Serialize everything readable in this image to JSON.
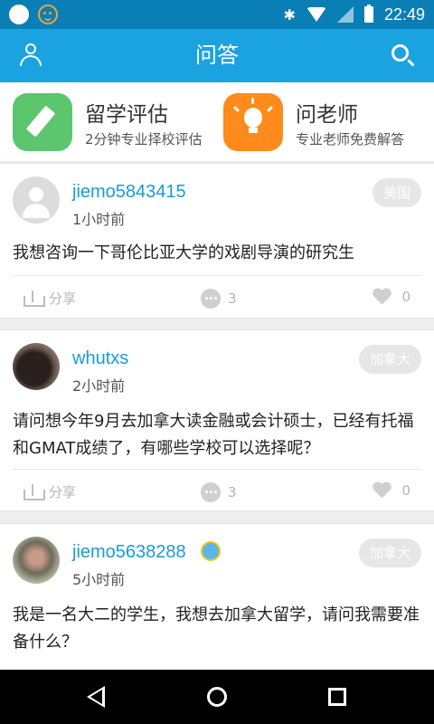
{
  "status_bar": {
    "time": "22:49",
    "bluetooth": "✱"
  },
  "app_bar": {
    "title": "问答"
  },
  "quick_actions": [
    {
      "title": "留学评估",
      "subtitle": "2分钟专业择校评估",
      "icon": "pencil-icon",
      "color": "#5bc66e"
    },
    {
      "title": "问老师",
      "subtitle": "专业老师免费解答",
      "icon": "lightbulb-icon",
      "color": "#ff8b1c"
    }
  ],
  "posts": [
    {
      "username": "jiemo5843415",
      "time": "1小时前",
      "tag": "美国",
      "question": "我想咨询一下哥伦比亚大学的戏剧导演的研究生",
      "share_label": "分享",
      "comments": "3",
      "likes": "0"
    },
    {
      "username": "whutxs",
      "time": "2小时前",
      "tag": "加拿大",
      "question": "请问想今年9月去加拿大读金融或会计硕士，已经有托福和GMAT成绩了，有哪些学校可以选择呢？",
      "share_label": "分享",
      "comments": "3",
      "likes": "0"
    },
    {
      "username": "jiemo5638288",
      "time": "5小时前",
      "tag": "加拿大",
      "question": "我是一名大二的学生，我想去加拿大留学，请问我需要准备什么？"
    }
  ],
  "colors": {
    "status_bar": "#0a7fb6",
    "app_bar": "#1aa3e0",
    "username": "#1a9bd8"
  }
}
